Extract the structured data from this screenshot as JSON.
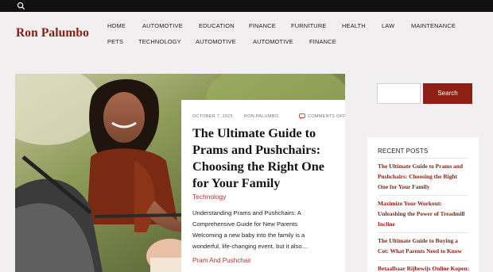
{
  "topbar": {
    "search_icon": "search-icon"
  },
  "brand": {
    "name": "Ron Palumbo"
  },
  "nav": {
    "items": [
      "Home",
      "Automotive",
      "Education",
      "Finance",
      "Furniture",
      "Health",
      "Law",
      "Maintenance",
      "Pets",
      "Technology",
      "Automotive",
      "Automotive",
      "Finance"
    ]
  },
  "featured": {
    "date": "October 7, 2025",
    "author": "Ron Palumbo",
    "comments": "Comments Off",
    "title_lines": [
      "The Ultimate Guide to",
      "Prams and Pushchairs:",
      "Choosing the Right One",
      "for Your Family"
    ],
    "category": "Technology",
    "excerpt_lines": [
      "Understanding Prams and Pushchairs: A",
      "Comprehensive Guide for New Parents",
      "Welcoming a new baby into the family is a",
      "wonderful, life-changing event, but it also…"
    ],
    "tag": "Pram And Pushchair"
  },
  "sidebar": {
    "search_placeholder": "",
    "search_button": "Search",
    "recent_heading": "Recent Posts",
    "posts": [
      [
        "The Ultimate Guide to Prams and",
        "Pushchairs: Choosing the Right",
        "One for Your Family"
      ],
      [
        "Maximize Your Workout:",
        "Unleashing the Power of Treadmill",
        "Incline"
      ],
      [
        "The Ultimate Guide to Buying a",
        "Cot: What Parents Need to Know"
      ],
      [
        "Betaalbaar Rijbewijs Online Kopen:"
      ]
    ]
  },
  "colors": {
    "brand": "#8b1b13",
    "accent": "#a43a26",
    "topbar": "#111111"
  }
}
